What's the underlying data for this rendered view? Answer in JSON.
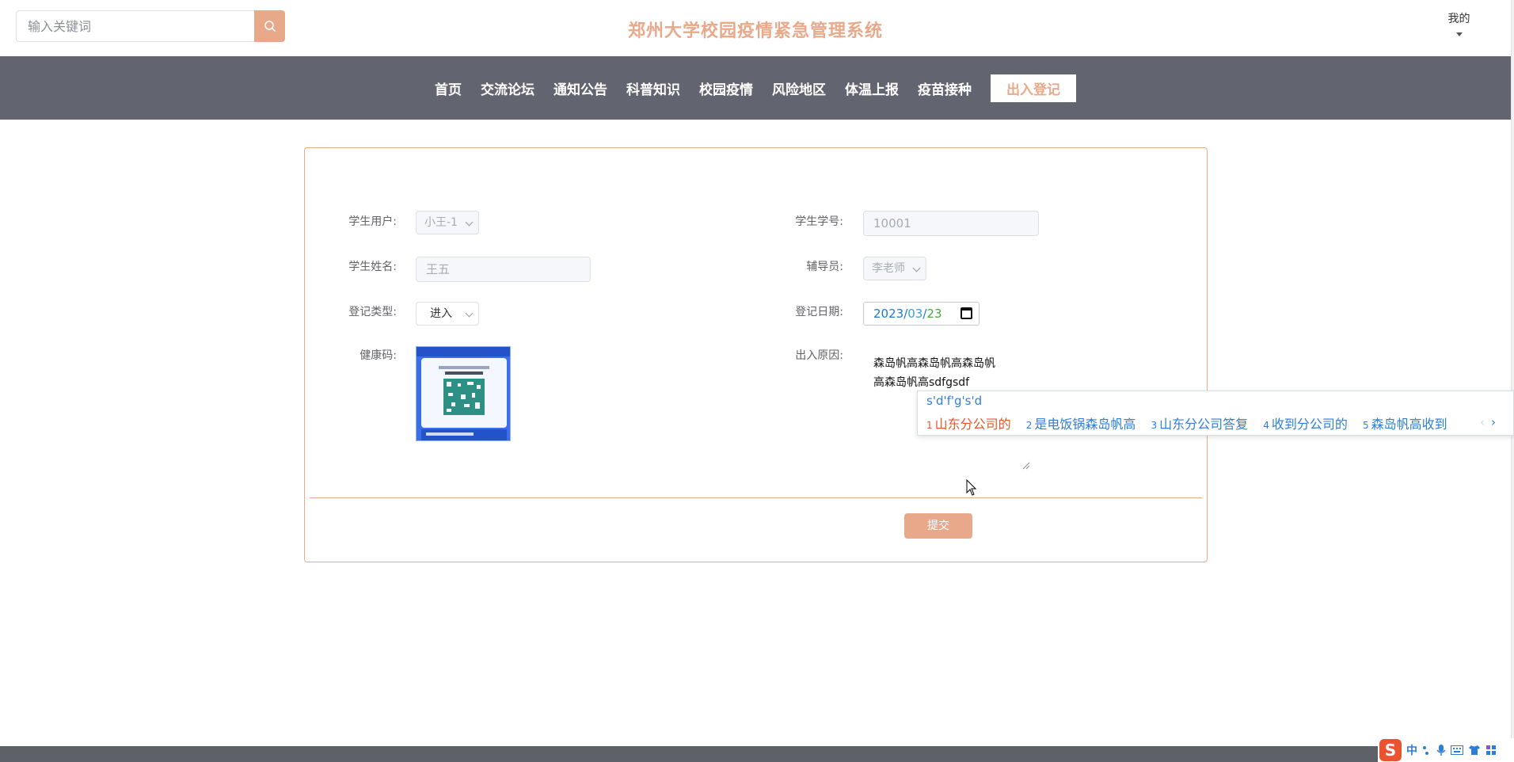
{
  "header": {
    "search_placeholder": "输入关键词",
    "site_title": "郑州大学校园疫情紧急管理系统",
    "user_menu_label": "我的"
  },
  "nav": {
    "items": [
      "首页",
      "交流论坛",
      "通知公告",
      "科普知识",
      "校园疫情",
      "风险地区",
      "体温上报",
      "疫苗接种"
    ],
    "active_label": "出入登记"
  },
  "form": {
    "student_user_label": "学生用户:",
    "student_user_value": "小王-1",
    "student_id_label": "学生学号:",
    "student_id_value": "10001",
    "student_name_label": "学生姓名:",
    "student_name_value": "王五",
    "counselor_label": "辅导员:",
    "counselor_value": "李老师",
    "reg_type_label": "登记类型:",
    "reg_type_value": "进入",
    "reg_date_label": "登记日期:",
    "reg_date": {
      "year": "2023",
      "month": "03",
      "day": "23"
    },
    "health_code_label": "健康码:",
    "reason_label": "出入原因:",
    "reason_value": "森岛帆高森岛帆高森岛帆\n高森岛帆高sdfgsdf",
    "submit_label": "提交"
  },
  "ime": {
    "composition": "s'd'f'g's'd",
    "candidates": [
      {
        "num": "1",
        "text": "山东分公司的"
      },
      {
        "num": "2",
        "text": "是电饭锅森岛帆高"
      },
      {
        "num": "3",
        "text": "山东分公司答复"
      },
      {
        "num": "4",
        "text": "收到分公司的"
      },
      {
        "num": "5",
        "text": "森岛帆高收到"
      }
    ],
    "prev_arrow": "‹",
    "next_arrow": "›",
    "toolbar_logo": "S",
    "toolbar_mode": "中"
  },
  "colors": {
    "accent": "#e8a98b",
    "nav_bg": "#626570",
    "ime_blue": "#2f7ed6",
    "ime_highlight": "#e2582b"
  }
}
